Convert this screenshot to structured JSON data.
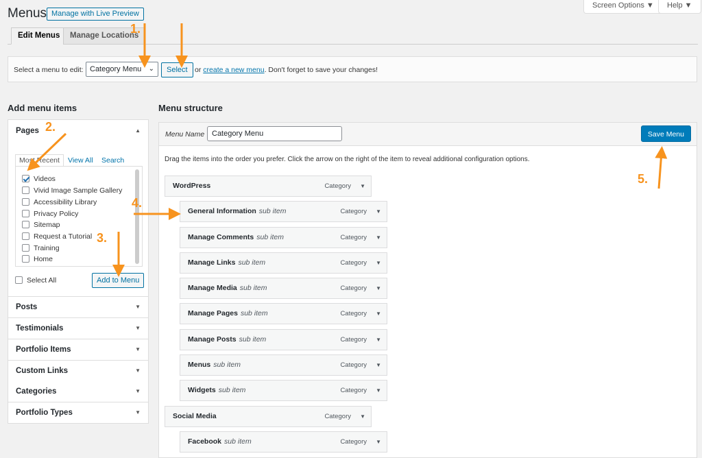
{
  "header": {
    "title": "Menus",
    "live_preview": "Manage with Live Preview",
    "screen_options": "Screen Options ▼",
    "help": "Help ▼"
  },
  "tabs": [
    {
      "label": "Edit Menus"
    },
    {
      "label": "Manage Locations"
    }
  ],
  "select_bar": {
    "label": "Select a menu to edit:",
    "selected": "Category Menu",
    "select_button": "Select",
    "or": "or",
    "create_link": "create a new menu",
    "save_hint": ". Don't forget to save your changes!"
  },
  "left": {
    "heading": "Add menu items",
    "pages": {
      "title": "Pages",
      "tabs": [
        "Most Recent",
        "View All",
        "Search"
      ],
      "items": [
        {
          "label": "Videos",
          "checked": true
        },
        {
          "label": "Vivid Image Sample Gallery",
          "checked": false
        },
        {
          "label": "Accessibility Library",
          "checked": false
        },
        {
          "label": "Privacy Policy",
          "checked": false
        },
        {
          "label": "Sitemap",
          "checked": false
        },
        {
          "label": "Request a Tutorial",
          "checked": false
        },
        {
          "label": "Training",
          "checked": false
        },
        {
          "label": "Home",
          "checked": false
        }
      ],
      "select_all": "Select All",
      "add_button": "Add to Menu"
    },
    "sections": [
      "Posts",
      "Testimonials",
      "Portfolio Items",
      "Custom Links",
      "Categories",
      "Portfolio Types"
    ]
  },
  "right": {
    "heading": "Menu structure",
    "menu_name_label": "Menu Name",
    "menu_name_value": "Category Menu",
    "save_button": "Save Menu",
    "drag_hint": "Drag the items into the order you prefer. Click the arrow on the right of the item to reveal additional configuration options.",
    "items": [
      {
        "label": "WordPress",
        "sub": "",
        "type": "Category"
      },
      {
        "label": "General Information",
        "sub": "sub item",
        "type": "Category"
      },
      {
        "label": "Manage Comments",
        "sub": "sub item",
        "type": "Category"
      },
      {
        "label": "Manage Links",
        "sub": "sub item",
        "type": "Category"
      },
      {
        "label": "Manage Media",
        "sub": "sub item",
        "type": "Category"
      },
      {
        "label": "Manage Pages",
        "sub": "sub item",
        "type": "Category"
      },
      {
        "label": "Manage Posts",
        "sub": "sub item",
        "type": "Category"
      },
      {
        "label": "Menus",
        "sub": "sub item",
        "type": "Category"
      },
      {
        "label": "Widgets",
        "sub": "sub item",
        "type": "Category"
      },
      {
        "label": "Social Media",
        "sub": "",
        "type": "Category"
      },
      {
        "label": "Facebook",
        "sub": "sub item",
        "type": "Category"
      }
    ]
  },
  "annotations": {
    "step1": "1.",
    "step2": "2.",
    "step3": "3.",
    "step4": "4.",
    "step5": "5.",
    "color": "#f7931e"
  }
}
